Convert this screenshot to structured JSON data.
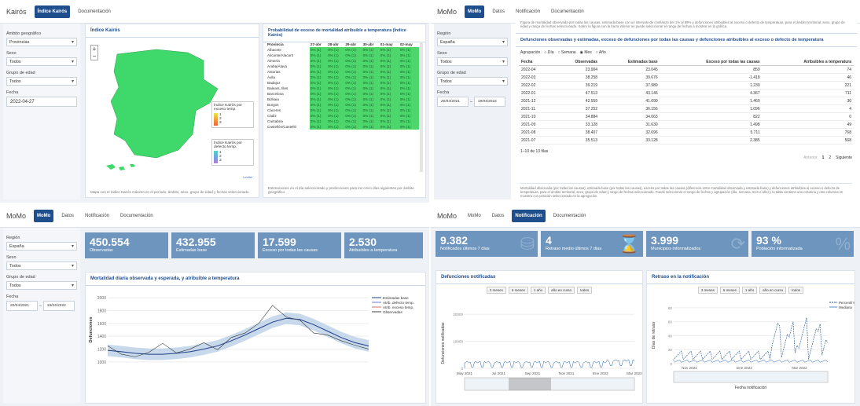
{
  "q1": {
    "brand": "Kairós",
    "tabs": [
      "Índice Kairós",
      "Documentación"
    ],
    "side": {
      "l1": "Ámbito geográfico",
      "v1": "Provincias",
      "l2": "Sexo",
      "v2": "Todos",
      "l3": "Grupo de edad",
      "v3": "Todos",
      "l4": "Fecha",
      "v4": "2022-04-27"
    },
    "map_title": "Índice Kairós",
    "map_legend1": "Índice Kairós por exceso temp.",
    "map_legend2": "Índice Kairós por defecto temp.",
    "legend_nums": [
      "1",
      "2",
      "3"
    ],
    "map_note": "Mapa con el índice Kairós máximo en el período, ámbito, sexo, grupo de edad y fechas seleccionado.",
    "attrib": "Leaflet",
    "prob_title": "Probabilidad de exceso de mortalidad atribuible a temperatura (Índice Kairós)",
    "prob_cols": [
      "Provincia",
      "27-abr",
      "28-abr",
      "29-abr",
      "30-abr",
      "01-may",
      "02-may"
    ],
    "prob_rows": [
      "Albacete",
      "Alicante/Alacant",
      "Almería",
      "Araba/Álava",
      "Asturias",
      "Ávila",
      "Badajoz",
      "Balears, Illes",
      "Barcelona",
      "Bizkaia",
      "Burgos",
      "Cáceres",
      "Cádiz",
      "Cantabria",
      "Castellón/Castelló"
    ],
    "prob_cell": "0% (1)",
    "prob_note": "Estimaciones en el día seleccionado y predicciones para los cinco días siguientes por ámbito geográfico."
  },
  "q2": {
    "brand": "MoMo",
    "tabs": [
      "MoMo",
      "Datos",
      "Notificación",
      "Documentación"
    ],
    "side": {
      "l1": "Región",
      "v1": "España",
      "l2": "Sexo",
      "v2": "Todos",
      "l3": "Grupo de edad",
      "v3": "Todos",
      "l4": "Fecha",
      "d1": "20/04/2021",
      "d2": "19/04/2022"
    },
    "intro": "Figura de mortalidad observada por todas las causas, estimada base con un intervalo de confianza del 1% al 99% y defunciones atribuibles al exceso o defecto de temperatura, para el ámbito territorial, sexo, grupo de edad y rango de fechas seleccionado. Sobre la figura con la barra inferior se puede seleccionar el rango de fechas a mostrar en la gráfica.",
    "table_title": "Defunciones observadas y estimadas, exceso de defunciones por todas las causas y defunciones atribuibles al exceso o defecto de temperatura",
    "agrup": "Agrupación",
    "agrup_opts": [
      "Día",
      "Semana",
      "Mes",
      "Año"
    ],
    "cols": [
      "Fecha",
      "Observadas",
      "Estimadas base",
      "Exceso por todas las causas",
      "Atribuibles a temperatura"
    ],
    "rows": [
      [
        "2022-04",
        "23.904",
        "23.045",
        "859",
        "74"
      ],
      [
        "2022-03",
        "38.258",
        "39.676",
        "-1.418",
        "46"
      ],
      [
        "2022-02",
        "39.219",
        "37.989",
        "1.230",
        "221"
      ],
      [
        "2022-01",
        "47.513",
        "43.146",
        "4.367",
        "711"
      ],
      [
        "2021-12",
        "42.559",
        "41.099",
        "1.460",
        "30"
      ],
      [
        "2021-11",
        "37.252",
        "36.156",
        "1.096",
        "4"
      ],
      [
        "2021-10",
        "34.884",
        "34.063",
        "822",
        "0"
      ],
      [
        "2021-09",
        "33.128",
        "31.630",
        "1.498",
        "49"
      ],
      [
        "2021-08",
        "38.407",
        "32.696",
        "5.711",
        "768"
      ],
      [
        "2021-07",
        "35.513",
        "33.128",
        "2.385",
        "568"
      ]
    ],
    "info": "1–10 de 13 filas",
    "pag": [
      "Anterior",
      "1",
      "2",
      "Siguiente"
    ],
    "foot": "Mortalidad observada (por todas las causas), estimada base (por todas las causas), exceso por todas las causas (diferencia entre mortalidad observada y estimada base) y defunciones atribuibles al exceso o defecto de temperatura, para el ámbito territorial, sexo, grupo de edad y rango de fechas seleccionado. Puede seleccionar el rango de fechas y agrupación (día, semana, mes o año) y la tabla contiene una columna y otra columna en muestra con posición seleccionada en la agregación."
  },
  "q3": {
    "brand": "MoMo",
    "tabs": [
      "MoMo",
      "Datos",
      "Notificación",
      "Documentación"
    ],
    "side": {
      "l1": "Región",
      "v1": "España",
      "l2": "Sexo",
      "v2": "Todos",
      "l3": "Grupo de edad",
      "v3": "Todos",
      "l4": "Fecha",
      "d1": "20/04/2021",
      "d2": "19/04/2022"
    },
    "kpis": [
      {
        "v": "450.554",
        "s": "Observadas"
      },
      {
        "v": "432.955",
        "s": "Estimadas base"
      },
      {
        "v": "17.599",
        "s": "Exceso por todas las causas"
      },
      {
        "v": "2.530",
        "s": "Atribuibles a temperatura"
      }
    ],
    "chart_title": "Mortalidad diaria observada y esperada, y atribuible a temperatura",
    "legend": [
      "Estimadas base",
      "Atrib. defecto temp.",
      "Atrib. exceso temp.",
      "Observadas"
    ]
  },
  "q4": {
    "brand": "MoMo",
    "tabs": [
      "MoMo",
      "Datos",
      "Notificación",
      "Documentación"
    ],
    "kpis": [
      {
        "v": "9.382",
        "s": "Notificados últimos 7 días"
      },
      {
        "v": "4",
        "s": "Retraso medio últimos 7 días"
      },
      {
        "v": "3.999",
        "s": "Municipios informatizados"
      },
      {
        "v": "93 %",
        "s": "Población informatizada"
      }
    ],
    "p1_title": "Defunciones notificadas",
    "p2_title": "Retraso en la notificación",
    "ranges": [
      "3 meses",
      "6 meses",
      "1 año",
      "año en curso",
      "todos"
    ],
    "p1_ylabel": "Defunciones notificadas",
    "p2_ylabel": "Días de retraso",
    "p2_xlabel": "Fecha notificación",
    "p2_legend": [
      "Percentil 90",
      "Mediana"
    ],
    "p1_x": [
      "May 2021",
      "Jul 2021",
      "Sep 2021",
      "Nov 2021",
      "Ene 2022",
      "Mar 2022"
    ],
    "p2_x": [
      "Nov 2021",
      "Ene 2022",
      "Mar 2022"
    ]
  },
  "chart_data": [
    {
      "type": "line",
      "title": "Mortalidad diaria observada y esperada, y atribuible a temperatura",
      "ylabel": "Defunciones",
      "ylim": [
        950,
        2050
      ],
      "yticks": [
        1000,
        1200,
        1400,
        1600,
        1800,
        2000
      ],
      "series": [
        {
          "name": "Estimadas base",
          "values": [
            1180,
            1160,
            1135,
            1120,
            1120,
            1135,
            1160,
            1200,
            1250,
            1330,
            1420,
            1520,
            1620,
            1680,
            1660,
            1580,
            1480,
            1380,
            1300,
            1250
          ]
        },
        {
          "name": "Observadas",
          "values": [
            1250,
            1120,
            1080,
            1150,
            1290,
            1140,
            1200,
            1300,
            1190,
            1380,
            1450,
            1600,
            1880,
            1700,
            1650,
            1450,
            1420,
            1330,
            1260,
            1200
          ]
        }
      ]
    },
    {
      "type": "bar",
      "title": "Defunciones notificadas",
      "ylabel": "Defunciones notificadas",
      "yticks": [
        0,
        10000,
        20000
      ],
      "x": [
        "May 2021",
        "Jul 2021",
        "Sep 2021",
        "Nov 2021",
        "Ene 2022",
        "Mar 2022"
      ]
    },
    {
      "type": "line",
      "title": "Retraso en la notificación",
      "ylabel": "Días de retraso",
      "xlabel": "Fecha notificación",
      "yticks": [
        0,
        20,
        40,
        60,
        80
      ],
      "series": [
        {
          "name": "Percentil 90"
        },
        {
          "name": "Mediana"
        }
      ]
    }
  ]
}
